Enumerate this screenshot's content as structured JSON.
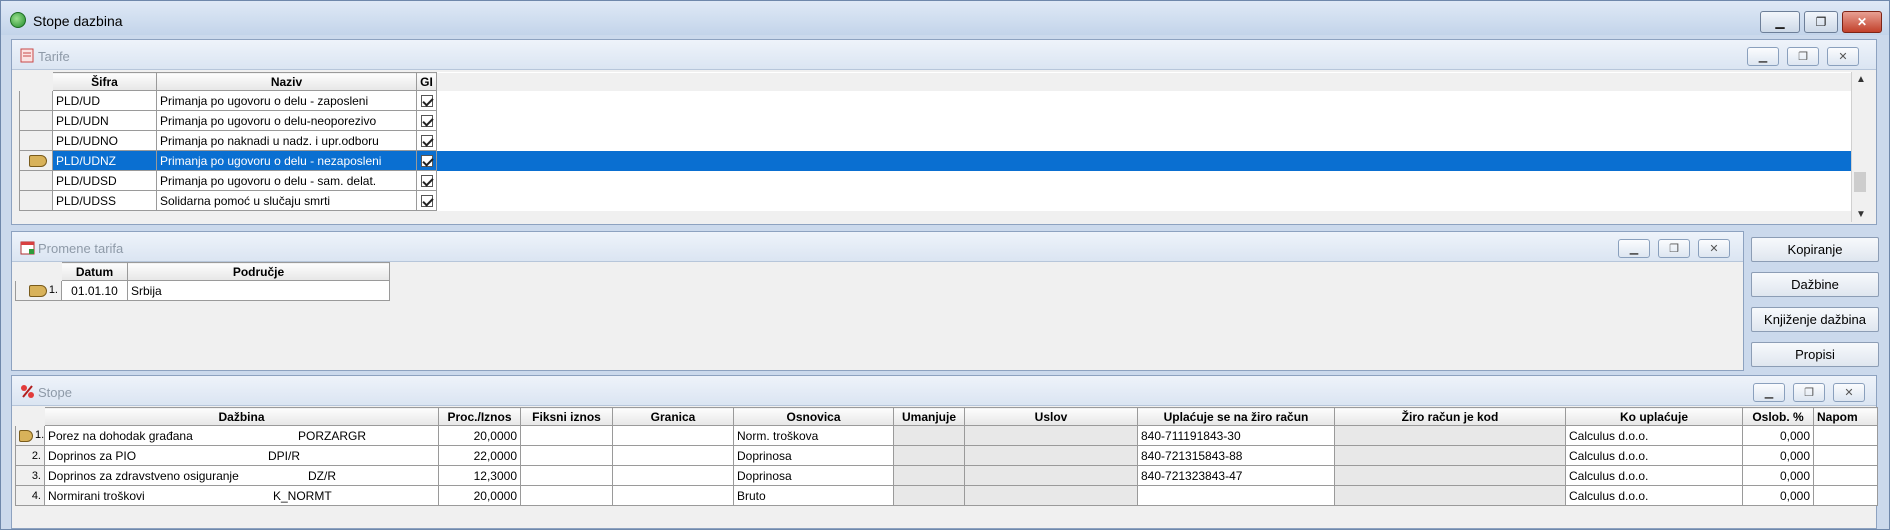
{
  "window": {
    "title": "Stope dazbina"
  },
  "tarife": {
    "title": "Tarife",
    "columns": [
      "Šifra",
      "Naziv",
      "GI"
    ],
    "rows": [
      {
        "sifra": "PLD/UD",
        "naziv": "Primanja po ugovoru o delu - zaposleni",
        "gi": true,
        "selected": false
      },
      {
        "sifra": "PLD/UDN",
        "naziv": "Primanja po ugovoru o delu-neoporezivo",
        "gi": true,
        "selected": false
      },
      {
        "sifra": "PLD/UDNO",
        "naziv": "Primanja po naknadi u nadz. i upr.odboru",
        "gi": true,
        "selected": false
      },
      {
        "sifra": "PLD/UDNZ",
        "naziv": "Primanja po ugovoru o delu - nezaposleni",
        "gi": true,
        "selected": true
      },
      {
        "sifra": "PLD/UDSD",
        "naziv": "Primanja po ugovoru o delu - sam. delat.",
        "gi": true,
        "selected": false
      },
      {
        "sifra": "PLD/UDSS",
        "naziv": "Solidarna pomoć u slučaju smrti",
        "gi": true,
        "selected": false
      }
    ]
  },
  "promene": {
    "title": "Promene tarifa",
    "columns": [
      "Datum",
      "Područje"
    ],
    "rows": [
      {
        "no": "1.",
        "datum": "01.01.10",
        "podrucje": "Srbija"
      }
    ]
  },
  "buttons": {
    "kopiranje": "Kopiranje",
    "dazbine": "Dažbine",
    "knjizenje": "Knjiženje dažbina",
    "propisi": "Propisi"
  },
  "stope": {
    "title": "Stope",
    "columns": [
      "Dažbina",
      "Proc./Iznos",
      "Fiksni iznos",
      "Granica",
      "Osnovica",
      "Umanjuje",
      "Uslov",
      "Uplaćuje se na žiro račun",
      "Žiro račun je kod",
      "Ko uplaćuje",
      "Oslob. %",
      "Napom"
    ],
    "rows": [
      {
        "no": "1.",
        "naziv": "Porez na dohodak građana",
        "sifra": "PORZARGR",
        "proc": "20,0000",
        "osnovica": "Norm. troškova",
        "ziro": "840-711191843-30",
        "ko": "Calculus d.o.o.",
        "oslob": "0,000"
      },
      {
        "no": "2.",
        "naziv": "Doprinos za PIO",
        "sifra": "DPI/R",
        "proc": "22,0000",
        "osnovica": "Doprinosa",
        "ziro": "840-721315843-88",
        "ko": "Calculus d.o.o.",
        "oslob": "0,000"
      },
      {
        "no": "3.",
        "naziv": "Doprinos za zdravstveno osiguranje",
        "sifra": "DZ/R",
        "proc": "12,3000",
        "osnovica": "Doprinosa",
        "ziro": "840-721323843-47",
        "ko": "Calculus d.o.o.",
        "oslob": "0,000"
      },
      {
        "no": "4.",
        "naziv": "Normirani troškovi",
        "sifra": "K_NORMT",
        "proc": "20,0000",
        "osnovica": "Bruto",
        "ziro": "",
        "ko": "Calculus d.o.o.",
        "oslob": "0,000"
      }
    ]
  }
}
